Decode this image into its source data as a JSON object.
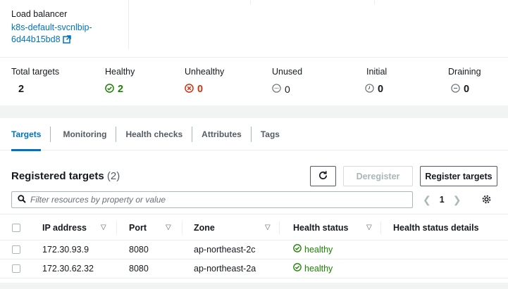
{
  "load_balancer": {
    "label": "Load balancer",
    "link_line1": "k8s-default-svcnlbip-",
    "link_line2": "6d44b15bd8"
  },
  "stats": [
    {
      "label": "Total targets",
      "value": "2",
      "status": "total"
    },
    {
      "label": "Healthy",
      "value": "2",
      "status": "healthy",
      "icon": "check-circle-icon",
      "color": "#1d8102"
    },
    {
      "label": "Unhealthy",
      "value": "0",
      "status": "unhealthy",
      "icon": "x-circle-icon",
      "color": "#d13212"
    },
    {
      "label": "Unused",
      "value": "0",
      "status": "unused",
      "icon": "minus-circle-icon",
      "color": "#687078"
    },
    {
      "label": "Initial",
      "value": "0",
      "status": "initial",
      "icon": "clock-icon",
      "color": "#687078"
    },
    {
      "label": "Draining",
      "value": "0",
      "status": "draining",
      "icon": "minus-circle-icon",
      "color": "#687078"
    }
  ],
  "tabs": [
    {
      "label": "Targets",
      "active": true
    },
    {
      "label": "Monitoring",
      "active": false
    },
    {
      "label": "Health checks",
      "active": false
    },
    {
      "label": "Attributes",
      "active": false
    },
    {
      "label": "Tags",
      "active": false
    }
  ],
  "registered_targets": {
    "title": "Registered targets",
    "count": "(2)",
    "deregister_label": "Deregister",
    "register_label": "Register targets",
    "filter_placeholder": "Filter resources by property or value",
    "page": "1"
  },
  "table": {
    "columns": [
      "IP address",
      "Port",
      "Zone",
      "Health status",
      "Health status details"
    ],
    "rows": [
      {
        "ip": "172.30.93.9",
        "port": "8080",
        "zone": "ap-northeast-2c",
        "health": "healthy",
        "details": ""
      },
      {
        "ip": "172.30.62.32",
        "port": "8080",
        "zone": "ap-northeast-2a",
        "health": "healthy",
        "details": ""
      }
    ]
  },
  "colors": {
    "accent": "#0073bb",
    "healthy": "#1d8102",
    "unhealthy": "#d13212",
    "neutral": "#687078"
  }
}
